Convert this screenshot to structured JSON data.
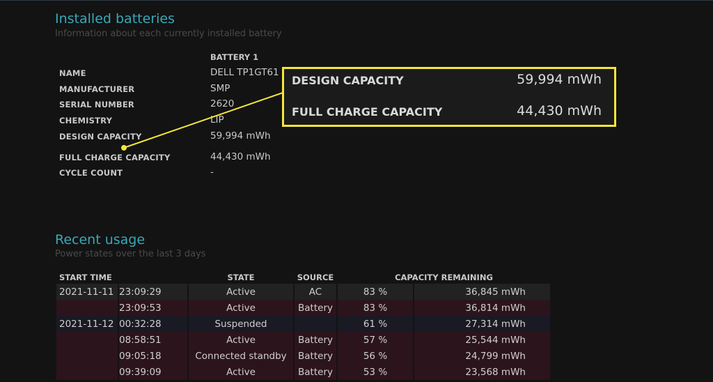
{
  "installed": {
    "title": "Installed batteries",
    "subtitle": "Information about each currently installed battery",
    "column_header": "BATTERY 1",
    "rows": [
      {
        "label": "NAME",
        "value": "DELL TP1GT61"
      },
      {
        "label": "MANUFACTURER",
        "value": "SMP"
      },
      {
        "label": "SERIAL NUMBER",
        "value": "2620"
      },
      {
        "label": "CHEMISTRY",
        "value": "LIP"
      },
      {
        "label": "DESIGN CAPACITY",
        "value": "59,994 mWh"
      },
      {
        "label": "FULL CHARGE CAPACITY",
        "value": "44,430 mWh"
      },
      {
        "label": "CYCLE COUNT",
        "value": "-"
      }
    ]
  },
  "callout": {
    "design_label": "DESIGN CAPACITY",
    "design_value": "59,994 mWh",
    "full_label": "FULL CHARGE CAPACITY",
    "full_value": "44,430 mWh",
    "highlight_color": "#f3e63a"
  },
  "usage": {
    "title": "Recent usage",
    "subtitle": "Power states over the last 3 days",
    "headers": {
      "start": "START TIME",
      "state": "STATE",
      "source": "SOURCE",
      "capacity": "CAPACITY REMAINING"
    },
    "rows": [
      {
        "date": "2021-11-11",
        "time": "23:09:29",
        "state": "Active",
        "source": "AC",
        "pct": "83 %",
        "mwh": "36,845 mWh"
      },
      {
        "date": "",
        "time": "23:09:53",
        "state": "Active",
        "source": "Battery",
        "pct": "83 %",
        "mwh": "36,814 mWh"
      },
      {
        "date": "2021-11-12",
        "time": "00:32:28",
        "state": "Suspended",
        "source": "",
        "pct": "61 %",
        "mwh": "27,314 mWh"
      },
      {
        "date": "",
        "time": "08:58:51",
        "state": "Active",
        "source": "Battery",
        "pct": "57 %",
        "mwh": "25,544 mWh"
      },
      {
        "date": "",
        "time": "09:05:18",
        "state": "Connected standby",
        "source": "Battery",
        "pct": "56 %",
        "mwh": "24,799 mWh"
      },
      {
        "date": "",
        "time": "09:39:09",
        "state": "Active",
        "source": "Battery",
        "pct": "53 %",
        "mwh": "23,568 mWh"
      }
    ]
  },
  "colors": {
    "accent": "#37a9b9",
    "background": "#131313"
  }
}
